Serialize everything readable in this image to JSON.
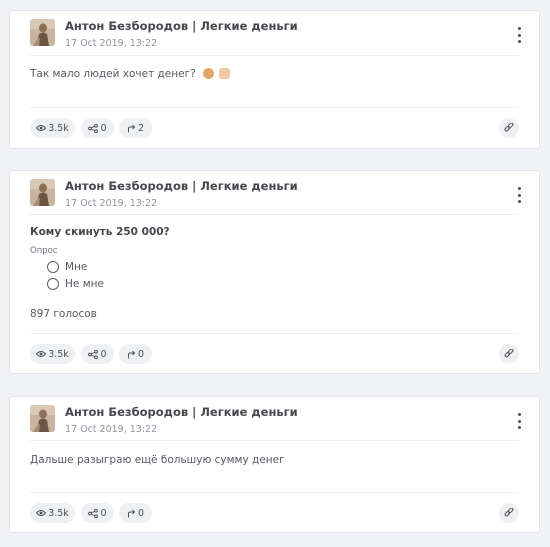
{
  "posts": [
    {
      "author": "Антон Безбородов | Легкие деньги",
      "date": "17 Oct 2019, 13:22",
      "text": "Так мало людей хочет денег?",
      "emojis": [
        "face-emoji",
        "pointing-hand-emoji"
      ],
      "stats": {
        "views": "3.5k",
        "shares": "0",
        "forwards": "2"
      }
    },
    {
      "author": "Антон Безбородов | Легкие деньги",
      "date": "17 Oct 2019, 13:22",
      "poll": {
        "question": "Кому скинуть 250 000?",
        "label": "Опрос",
        "options": [
          "Мне",
          "Не мне"
        ],
        "votes": "897 голосов"
      },
      "stats": {
        "views": "3.5k",
        "shares": "0",
        "forwards": "0"
      }
    },
    {
      "author": "Антон Безбородов | Легкие деньги",
      "date": "17 Oct 2019, 13:22",
      "text": "Дальше разыграю ещё большую сумму денег",
      "stats": {
        "views": "3.5k",
        "shares": "0",
        "forwards": "0"
      }
    }
  ],
  "icons": {
    "views": "eye-icon",
    "shares": "share-icon",
    "forwards": "forward-arrow-icon",
    "link": "link-icon",
    "menu": "more-vertical-icon"
  }
}
